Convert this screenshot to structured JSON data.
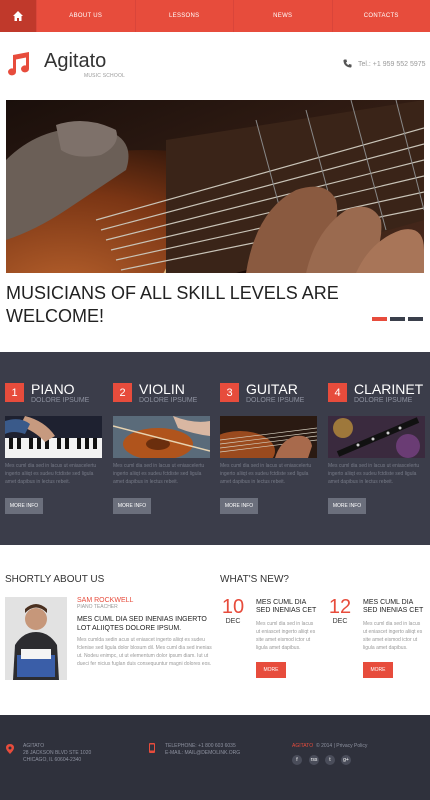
{
  "nav": {
    "items": [
      "About us",
      "Lessons",
      "News",
      "Contacts"
    ]
  },
  "header": {
    "title": "Agitato",
    "subtitle": "Music school",
    "phone": "Tel.: +1 959 552 5975"
  },
  "hero": {
    "slogan": "Musicians of all skill levels are welcome!",
    "slider_total": 3,
    "slider_active": 1
  },
  "lessons": [
    {
      "num": "1",
      "title": "Piano",
      "subtitle": "Dolore ipsume",
      "text": "Mes cuml dia sed in lacus ut eniascelertu ingerto aliiqt es sudeu fctdiste sed ligula amet dapibus in lectus rebeit.",
      "button": "More info"
    },
    {
      "num": "2",
      "title": "Violin",
      "subtitle": "Dolore ipsume",
      "text": "Mes cuml dia sed in lacus ut eniascelertu ingerto aliiqt es sudeu fctdiste sed ligula amet dapibus in lectus rebeit.",
      "button": "More info"
    },
    {
      "num": "3",
      "title": "Guitar",
      "subtitle": "Dolore ipsume",
      "text": "Mes cuml dia sed in lacus ut eniascelertu ingerto aliiqt es sudeu fctdiste sed ligula amet dapibus in lectus rebeit.",
      "button": "More info"
    },
    {
      "num": "4",
      "title": "Clarinet",
      "subtitle": "Dolore ipsume",
      "text": "Mes cuml dia sed in lacus ut eniascelertu ingerto aliiqt es sudeu fctdiste sed ligula amet dapibus in lectus rebeit.",
      "button": "More info"
    }
  ],
  "about": {
    "title": "Shortly about us",
    "name": "Sam Rockwell",
    "role": "Piano teacher",
    "heading": "Mes cuml dia sed inenias ingerto lot aliiqtes dolore ipsum.",
    "body": "Mes cumlda sedin acus ut eniascet ingerto aliiqt es sudeu fclenise sed ligula dolor blosum dil. Mes cuml dia sed inenias ut. Nodeu enimpc, ut ut elementum dolor ipsum diam. Iut ut dueci fer nicius fuglan duis consequuntur magni dolores eos."
  },
  "news": {
    "title": "What's new?",
    "items": [
      {
        "day": "10",
        "month": "Dec",
        "headline": "Mes cuml dia sed inenias cet",
        "body": "Mes cuml dia sed in lacus ut eniascet ingerto aliiqt es site amet eismod ictor ut ligula amet dapibus.",
        "button": "More"
      },
      {
        "day": "12",
        "month": "Dec",
        "headline": "Mes cuml dia sed inenias cet",
        "body": "Mes cuml dia sed in lacus ut eniascet ingerto aliiqt es site amet eismod ictor ut ligula amet dapibus.",
        "button": "More"
      }
    ]
  },
  "footer": {
    "address_name": "Agitato",
    "address_line1": "28 Jackson Blvd Ste 1020",
    "address_line2": "Chicago, IL 60604-2340",
    "telephone": "Telephone: +1 800 603 6035",
    "email": "E-mail: mail@demolink.org",
    "brand": "Agitato",
    "copyright": "© 2014 | Privacy Policy",
    "social": [
      "f",
      "rss",
      "t",
      "g+"
    ]
  },
  "colors": {
    "accent": "#e74c3c",
    "dark": "#3b3d4a",
    "footer": "#2f313c"
  }
}
